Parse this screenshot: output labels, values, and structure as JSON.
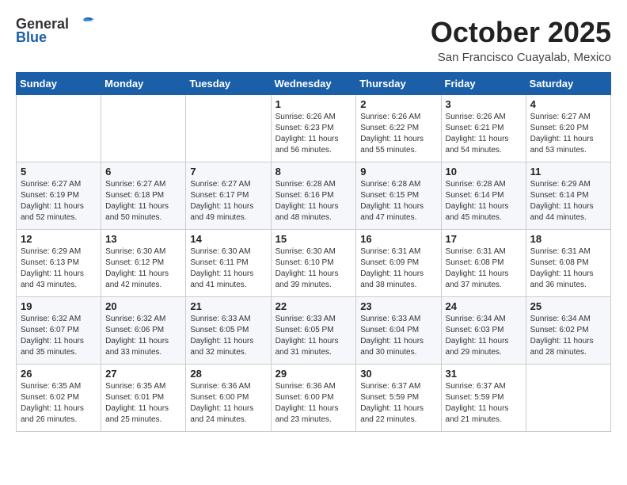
{
  "header": {
    "logo_general": "General",
    "logo_blue": "Blue",
    "month_title": "October 2025",
    "location": "San Francisco Cuayalab, Mexico"
  },
  "weekdays": [
    "Sunday",
    "Monday",
    "Tuesday",
    "Wednesday",
    "Thursday",
    "Friday",
    "Saturday"
  ],
  "weeks": [
    [
      {
        "day": "",
        "sunrise": "",
        "sunset": "",
        "daylight": ""
      },
      {
        "day": "",
        "sunrise": "",
        "sunset": "",
        "daylight": ""
      },
      {
        "day": "",
        "sunrise": "",
        "sunset": "",
        "daylight": ""
      },
      {
        "day": "1",
        "sunrise": "Sunrise: 6:26 AM",
        "sunset": "Sunset: 6:23 PM",
        "daylight": "Daylight: 11 hours and 56 minutes."
      },
      {
        "day": "2",
        "sunrise": "Sunrise: 6:26 AM",
        "sunset": "Sunset: 6:22 PM",
        "daylight": "Daylight: 11 hours and 55 minutes."
      },
      {
        "day": "3",
        "sunrise": "Sunrise: 6:26 AM",
        "sunset": "Sunset: 6:21 PM",
        "daylight": "Daylight: 11 hours and 54 minutes."
      },
      {
        "day": "4",
        "sunrise": "Sunrise: 6:27 AM",
        "sunset": "Sunset: 6:20 PM",
        "daylight": "Daylight: 11 hours and 53 minutes."
      }
    ],
    [
      {
        "day": "5",
        "sunrise": "Sunrise: 6:27 AM",
        "sunset": "Sunset: 6:19 PM",
        "daylight": "Daylight: 11 hours and 52 minutes."
      },
      {
        "day": "6",
        "sunrise": "Sunrise: 6:27 AM",
        "sunset": "Sunset: 6:18 PM",
        "daylight": "Daylight: 11 hours and 50 minutes."
      },
      {
        "day": "7",
        "sunrise": "Sunrise: 6:27 AM",
        "sunset": "Sunset: 6:17 PM",
        "daylight": "Daylight: 11 hours and 49 minutes."
      },
      {
        "day": "8",
        "sunrise": "Sunrise: 6:28 AM",
        "sunset": "Sunset: 6:16 PM",
        "daylight": "Daylight: 11 hours and 48 minutes."
      },
      {
        "day": "9",
        "sunrise": "Sunrise: 6:28 AM",
        "sunset": "Sunset: 6:15 PM",
        "daylight": "Daylight: 11 hours and 47 minutes."
      },
      {
        "day": "10",
        "sunrise": "Sunrise: 6:28 AM",
        "sunset": "Sunset: 6:14 PM",
        "daylight": "Daylight: 11 hours and 45 minutes."
      },
      {
        "day": "11",
        "sunrise": "Sunrise: 6:29 AM",
        "sunset": "Sunset: 6:14 PM",
        "daylight": "Daylight: 11 hours and 44 minutes."
      }
    ],
    [
      {
        "day": "12",
        "sunrise": "Sunrise: 6:29 AM",
        "sunset": "Sunset: 6:13 PM",
        "daylight": "Daylight: 11 hours and 43 minutes."
      },
      {
        "day": "13",
        "sunrise": "Sunrise: 6:30 AM",
        "sunset": "Sunset: 6:12 PM",
        "daylight": "Daylight: 11 hours and 42 minutes."
      },
      {
        "day": "14",
        "sunrise": "Sunrise: 6:30 AM",
        "sunset": "Sunset: 6:11 PM",
        "daylight": "Daylight: 11 hours and 41 minutes."
      },
      {
        "day": "15",
        "sunrise": "Sunrise: 6:30 AM",
        "sunset": "Sunset: 6:10 PM",
        "daylight": "Daylight: 11 hours and 39 minutes."
      },
      {
        "day": "16",
        "sunrise": "Sunrise: 6:31 AM",
        "sunset": "Sunset: 6:09 PM",
        "daylight": "Daylight: 11 hours and 38 minutes."
      },
      {
        "day": "17",
        "sunrise": "Sunrise: 6:31 AM",
        "sunset": "Sunset: 6:08 PM",
        "daylight": "Daylight: 11 hours and 37 minutes."
      },
      {
        "day": "18",
        "sunrise": "Sunrise: 6:31 AM",
        "sunset": "Sunset: 6:08 PM",
        "daylight": "Daylight: 11 hours and 36 minutes."
      }
    ],
    [
      {
        "day": "19",
        "sunrise": "Sunrise: 6:32 AM",
        "sunset": "Sunset: 6:07 PM",
        "daylight": "Daylight: 11 hours and 35 minutes."
      },
      {
        "day": "20",
        "sunrise": "Sunrise: 6:32 AM",
        "sunset": "Sunset: 6:06 PM",
        "daylight": "Daylight: 11 hours and 33 minutes."
      },
      {
        "day": "21",
        "sunrise": "Sunrise: 6:33 AM",
        "sunset": "Sunset: 6:05 PM",
        "daylight": "Daylight: 11 hours and 32 minutes."
      },
      {
        "day": "22",
        "sunrise": "Sunrise: 6:33 AM",
        "sunset": "Sunset: 6:05 PM",
        "daylight": "Daylight: 11 hours and 31 minutes."
      },
      {
        "day": "23",
        "sunrise": "Sunrise: 6:33 AM",
        "sunset": "Sunset: 6:04 PM",
        "daylight": "Daylight: 11 hours and 30 minutes."
      },
      {
        "day": "24",
        "sunrise": "Sunrise: 6:34 AM",
        "sunset": "Sunset: 6:03 PM",
        "daylight": "Daylight: 11 hours and 29 minutes."
      },
      {
        "day": "25",
        "sunrise": "Sunrise: 6:34 AM",
        "sunset": "Sunset: 6:02 PM",
        "daylight": "Daylight: 11 hours and 28 minutes."
      }
    ],
    [
      {
        "day": "26",
        "sunrise": "Sunrise: 6:35 AM",
        "sunset": "Sunset: 6:02 PM",
        "daylight": "Daylight: 11 hours and 26 minutes."
      },
      {
        "day": "27",
        "sunrise": "Sunrise: 6:35 AM",
        "sunset": "Sunset: 6:01 PM",
        "daylight": "Daylight: 11 hours and 25 minutes."
      },
      {
        "day": "28",
        "sunrise": "Sunrise: 6:36 AM",
        "sunset": "Sunset: 6:00 PM",
        "daylight": "Daylight: 11 hours and 24 minutes."
      },
      {
        "day": "29",
        "sunrise": "Sunrise: 6:36 AM",
        "sunset": "Sunset: 6:00 PM",
        "daylight": "Daylight: 11 hours and 23 minutes."
      },
      {
        "day": "30",
        "sunrise": "Sunrise: 6:37 AM",
        "sunset": "Sunset: 5:59 PM",
        "daylight": "Daylight: 11 hours and 22 minutes."
      },
      {
        "day": "31",
        "sunrise": "Sunrise: 6:37 AM",
        "sunset": "Sunset: 5:59 PM",
        "daylight": "Daylight: 11 hours and 21 minutes."
      },
      {
        "day": "",
        "sunrise": "",
        "sunset": "",
        "daylight": ""
      }
    ]
  ]
}
